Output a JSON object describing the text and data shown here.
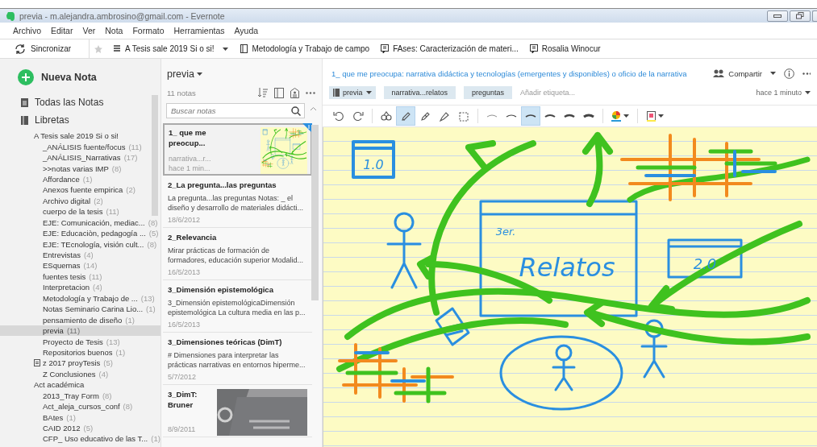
{
  "window": {
    "title": "previa - m.alejandra.ambrosino@gmail.com - Evernote"
  },
  "menu": [
    "Archivo",
    "Editar",
    "Ver",
    "Nota",
    "Formato",
    "Herramientas",
    "Ayuda"
  ],
  "toolbar": {
    "sync": "Sincronizar",
    "shortcuts": [
      {
        "label": "A Tesis sale 2019 Si o si!",
        "kind": "stack"
      },
      {
        "label": "Metodología y Trabajo de campo",
        "kind": "notebook"
      },
      {
        "label": "FAses: Caracterización de materi...",
        "kind": "note"
      },
      {
        "label": "Rosalia Winocur",
        "kind": "note"
      }
    ]
  },
  "sidebar": {
    "new_note": "Nueva Nota",
    "all_notes": "Todas las Notas",
    "notebooks_label": "Libretas",
    "items": [
      {
        "label": "A Tesis sale 2019 Si o si!",
        "children": [
          {
            "label": "_ANÁLISIS fuente/focus",
            "count": "(11)",
            "selected": false
          },
          {
            "label": "_ANÁLISIS_Narrativas",
            "count": "(17)",
            "selected": false
          },
          {
            "label": ">>notas varias IMP",
            "count": "(8)",
            "selected": false
          },
          {
            "label": "Affordance",
            "count": "(1)",
            "selected": false
          },
          {
            "label": "Anexos fuente empirica",
            "count": "(2)",
            "selected": false
          },
          {
            "label": "Archivo digital",
            "count": "(2)",
            "selected": false
          },
          {
            "label": "cuerpo de la tesis",
            "count": "(11)",
            "selected": false
          },
          {
            "label": "EJE: Comunicación, mediac...",
            "count": "(8)",
            "selected": false
          },
          {
            "label": "EJE: Educaciòn, pedagogía ...",
            "count": "(5)",
            "selected": false
          },
          {
            "label": "EJE: TEcnología, visión cult...",
            "count": "(8)",
            "selected": false
          },
          {
            "label": "Entrevistas",
            "count": "(4)",
            "selected": false
          },
          {
            "label": "ESquemas",
            "count": "(14)",
            "selected": false
          },
          {
            "label": "fuentes tesis",
            "count": "(11)",
            "selected": false
          },
          {
            "label": "Interpretacion",
            "count": "(4)",
            "selected": false
          },
          {
            "label": "Metodología y Trabajo de ...",
            "count": "(13)",
            "selected": false
          },
          {
            "label": "Notas Seminario Carina Lio...",
            "count": "(1)",
            "selected": false
          },
          {
            "label": "pensamiento de diseño",
            "count": "(1)",
            "selected": false
          },
          {
            "label": "previa",
            "count": "(11)",
            "selected": true
          },
          {
            "label": "Proyecto de Tesis",
            "count": "(13)",
            "selected": false
          },
          {
            "label": "Repositorios buenos",
            "count": "(1)",
            "selected": false
          },
          {
            "label": "z 2017 proyTesis",
            "count": "(5)",
            "selected": false,
            "kind": "shared"
          },
          {
            "label": "Z Conclusiones",
            "count": "(4)",
            "selected": false
          }
        ]
      },
      {
        "label": "Act académica",
        "children": [
          {
            "label": "2013_Tray Form",
            "count": "(8)",
            "selected": false
          },
          {
            "label": "Act_aleja_cursos_conf",
            "count": "(8)",
            "selected": false
          },
          {
            "label": "BAtes",
            "count": "(1)",
            "selected": false
          },
          {
            "label": "CAID 2012",
            "count": "(5)",
            "selected": false
          },
          {
            "label": "CFP_ Uso educativo de las T...",
            "count": "(1)",
            "selected": false
          }
        ]
      }
    ]
  },
  "note_list": {
    "notebook": "previa",
    "count": "11 notas",
    "search": {
      "placeholder": "Buscar notas"
    },
    "notes": [
      {
        "title": "1_ que me preocup...",
        "snippet": "narrativa...r...",
        "date": "hace 1 min...",
        "selected": true,
        "kind": "sketch"
      },
      {
        "title": "2_La pregunta...las preguntas",
        "snippet": "La pregunta...las preguntas Notas: _ el diseño y desarrollo de materiales didácti...",
        "date": "18/6/2012",
        "selected": false,
        "kind": "text"
      },
      {
        "title": "2_Relevancia",
        "snippet": "Mirar prácticas de formación de formadores, educación superior Modalid...",
        "date": "16/5/2013",
        "selected": false,
        "kind": "text"
      },
      {
        "title": "3_Dimensión epistemológica",
        "snippet": "3_Dimensión epistemológicaDimensión epistemológica La cultura media en las p...",
        "date": "16/5/2013",
        "selected": false,
        "kind": "text"
      },
      {
        "title": "3_Dimensiones teóricas (DimT)",
        "snippet": "# Dimensiones para interpretar las prácticas narrativas en entornos hiperme...",
        "date": "5/7/2012",
        "selected": false,
        "kind": "text"
      },
      {
        "title": "3_DimT: Bruner",
        "date": "8/9/2011",
        "selected": false,
        "kind": "picture"
      }
    ]
  },
  "editor": {
    "title": "1_ que me preocupa: narrativa didáctica y tecnologías (emergentes y disponibles) o oficio de la narrativa",
    "share": "Compartir",
    "notebook": "previa",
    "tags": [
      "narrativa...relatos",
      "preguntas"
    ],
    "tag_placeholder": "Añadir etiqueta...",
    "updated": "hace 1 minuto",
    "ink_tools": [
      {
        "kind": "undo",
        "selected": false
      },
      {
        "kind": "redo",
        "selected": false
      },
      {
        "kind": "shapes",
        "selected": false
      },
      {
        "kind": "pen",
        "selected": true
      },
      {
        "kind": "pen2",
        "selected": false
      },
      {
        "kind": "highlighter",
        "selected": false
      },
      {
        "kind": "select",
        "selected": false
      }
    ],
    "stroke_widths": [
      {
        "selected": false
      },
      {
        "selected": false
      },
      {
        "selected": true
      },
      {
        "selected": false
      },
      {
        "selected": false
      },
      {
        "selected": false
      }
    ],
    "sketch_labels": [
      "1.0",
      "3er.",
      "Relatos",
      "2.0"
    ]
  }
}
